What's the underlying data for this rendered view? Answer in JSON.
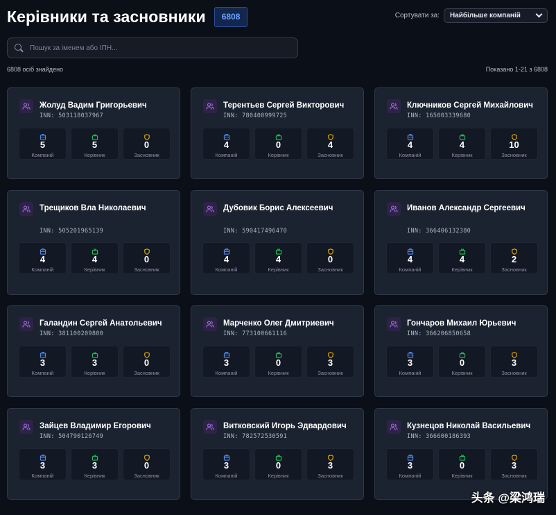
{
  "header": {
    "title": "Керівники та засновники",
    "count": "6808",
    "sort_label": "Сортувати за:",
    "sort_value": "Найбільше компаній"
  },
  "search": {
    "placeholder": "Пошук за іменем або ІПН..."
  },
  "meta": {
    "found": "6808 осіб знайдено",
    "range": "Показано 1-21 з 6808"
  },
  "labels": {
    "companies": "Компаній",
    "managers": "Керівник",
    "founders": "Засновник",
    "inn_prefix": "INN: "
  },
  "colors": {
    "companies": "#4f8df5",
    "managers": "#22c55e",
    "founders": "#eab308",
    "avatar": "#a070ea"
  },
  "people": [
    {
      "name": "Жолуд Вадим Григорьевич",
      "inn": "503118037967",
      "companies": "5",
      "managers": "5",
      "founders": "0"
    },
    {
      "name": "Терентьев Сергей Викторович",
      "inn": "780400999725",
      "companies": "4",
      "managers": "0",
      "founders": "4"
    },
    {
      "name": "Ключников Сергей Михайлович",
      "inn": "165003339680",
      "companies": "4",
      "managers": "4",
      "founders": "10"
    },
    {
      "name": "Трещиков Вла Николаевич",
      "inn": "505201965139",
      "companies": "4",
      "managers": "4",
      "founders": "0"
    },
    {
      "name": "Дубовик Борис Алексеевич",
      "inn": "590417496470",
      "companies": "4",
      "managers": "4",
      "founders": "0"
    },
    {
      "name": "Иванов Александр Сергеевич",
      "inn": "366406132380",
      "companies": "4",
      "managers": "4",
      "founders": "2"
    },
    {
      "name": "Галандин Сергей Анатольевич",
      "inn": "381100209800",
      "companies": "3",
      "managers": "3",
      "founders": "0"
    },
    {
      "name": "Марченко Олег Дмитриевич",
      "inn": "773100661116",
      "companies": "3",
      "managers": "0",
      "founders": "3"
    },
    {
      "name": "Гончаров Михаил Юрьевич",
      "inn": "366206850658",
      "companies": "3",
      "managers": "0",
      "founders": "3"
    },
    {
      "name": "Зайцев Владимир Егорович",
      "inn": "504790126749",
      "companies": "3",
      "managers": "3",
      "founders": "0"
    },
    {
      "name": "Витковский Игорь Эдвардович",
      "inn": "782572530591",
      "companies": "3",
      "managers": "0",
      "founders": "3"
    },
    {
      "name": "Кузнецов Николай Васильевич",
      "inn": "366600186393",
      "companies": "3",
      "managers": "0",
      "founders": "3"
    }
  ],
  "watermark": "头条 @梁鸿瑞"
}
